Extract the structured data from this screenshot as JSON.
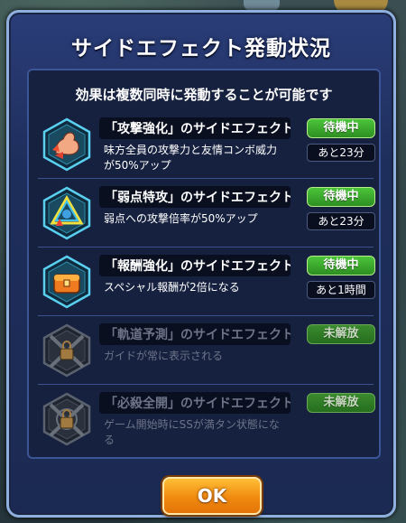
{
  "dialog": {
    "title": "サイドエフェクト発動状況",
    "subtitle": "効果は複数同時に発動することが可能です",
    "ok_label": "OK"
  },
  "effects": [
    {
      "name": "「攻撃強化」のサイドエフェクト",
      "description": "味方全員の攻撃力と友情コンボ威力が50%アップ",
      "status": "待機中",
      "time": "あと23分",
      "icon": "muscle-arm-icon",
      "locked": false
    },
    {
      "name": "「弱点特攻」のサイドエフェクト",
      "description": "弱点への攻撃倍率が50%アップ",
      "status": "待機中",
      "time": "あと23分",
      "icon": "weak-point-triangle-icon",
      "locked": false
    },
    {
      "name": "「報酬強化」のサイドエフェクト",
      "description": "スペシャル報酬が2倍になる",
      "status": "待機中",
      "time": "あと1時間",
      "icon": "treasure-chest-icon",
      "locked": false
    },
    {
      "name": "「軌道予測」のサイドエフェクト",
      "description": "ガイドが常に表示される",
      "status": "未解放",
      "time": "",
      "icon": "locked-trajectory-icon",
      "locked": true
    },
    {
      "name": "「必殺全開」のサイドエフェクト",
      "description": "ゲーム開始時にSSが満タン状態になる",
      "status": "未解放",
      "time": "",
      "icon": "locked-special-icon",
      "locked": true
    }
  ],
  "colors": {
    "dialog_bg": "#1e2e5c",
    "status_green": "#3ea82e",
    "ok_orange": "#f08a10"
  }
}
